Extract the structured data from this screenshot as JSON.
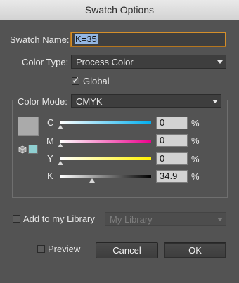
{
  "window": {
    "title": "Swatch Options"
  },
  "swatch_name": {
    "label": "Swatch Name:",
    "value": "K=35"
  },
  "color_type": {
    "label": "Color Type:",
    "value": "Process Color"
  },
  "global": {
    "label": "Global",
    "checked": true
  },
  "color_mode": {
    "label": "Color Mode:",
    "value": "CMYK"
  },
  "channels": [
    {
      "name": "C",
      "value": "0",
      "unit": "%",
      "level": 0,
      "color": "#00aeef"
    },
    {
      "name": "M",
      "value": "0",
      "unit": "%",
      "level": 0,
      "color": "#ec008c"
    },
    {
      "name": "Y",
      "value": "0",
      "unit": "%",
      "level": 0,
      "color": "#fff200"
    },
    {
      "name": "K",
      "value": "34.9",
      "unit": "%",
      "level": 0.349,
      "color": "#000000"
    }
  ],
  "swatch_preview_color": "#aaaaaa",
  "out_of_gamut_color": "#8fcfd1",
  "library": {
    "label": "Add to my Library",
    "checked": false,
    "select_value": "My Library"
  },
  "preview": {
    "label": "Preview",
    "checked": false
  },
  "buttons": {
    "cancel": "Cancel",
    "ok": "OK"
  }
}
